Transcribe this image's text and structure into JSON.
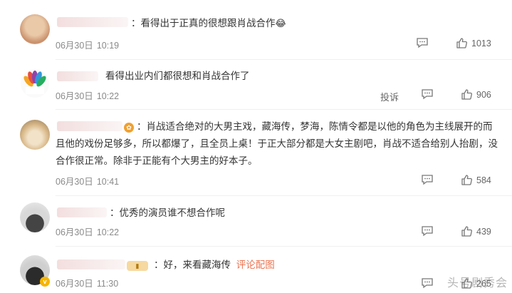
{
  "comments": [
    {
      "text": "：看得出于正真的很想跟肖战合作",
      "emoji": "😂",
      "date": "06月30日",
      "time": "10:19",
      "likes": "1013"
    },
    {
      "text": "看得出业内们都很想和肖战合作了",
      "date": "06月30日",
      "time": "10:22",
      "report": "投诉",
      "likes": "906"
    },
    {
      "lines": [
        "：肖战适合绝对的大男主戏，藏海传，梦海，陈情令都是以他的角色为主线展开的而",
        "且他的戏份足够多，所以都爆了，且全员上桌！于正大部分都是大女主剧吧，肖战不适合给别人抬剧，没",
        "合作很正常。除非于正能有个大男主的好本子。"
      ],
      "date": "06月30日",
      "time": "10:41",
      "likes": "584"
    },
    {
      "text": "：优秀的演员谁不想合作呢",
      "date": "06月30日",
      "time": "10:22",
      "likes": "439"
    },
    {
      "text": "：好，来看藏海传",
      "link": "评论配图",
      "date": "06月30日",
      "time": "11:30",
      "likes": "265"
    }
  ],
  "watermark": "头号剧秀会",
  "icons": {
    "reply": "reply-icon",
    "like": "thumbs-up-icon"
  },
  "colors": {
    "link": "#eb7350",
    "meta": "#8a8a8a"
  }
}
